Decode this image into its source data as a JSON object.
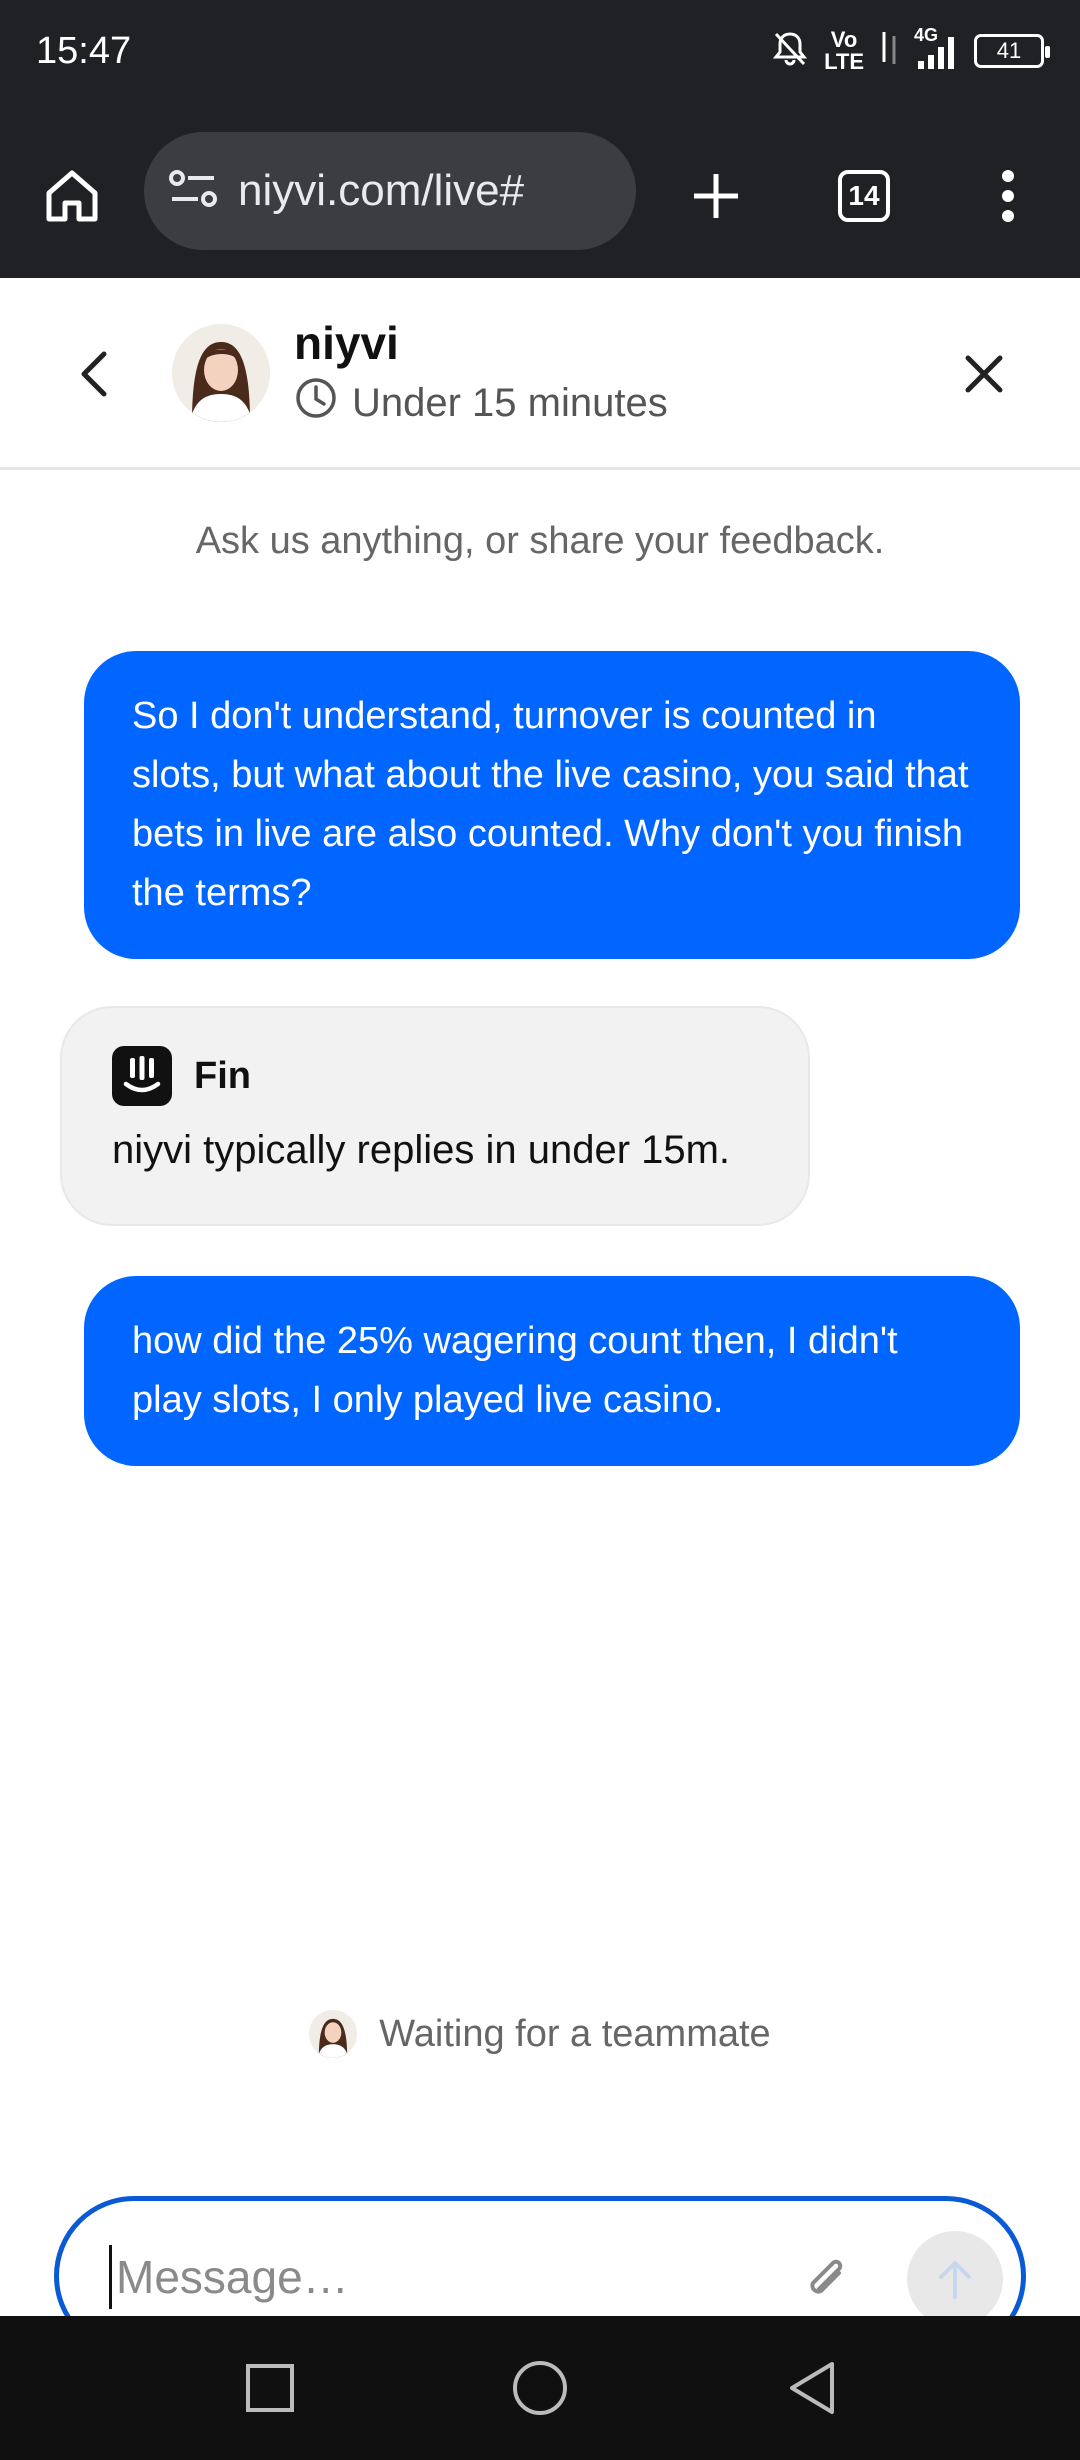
{
  "status_bar": {
    "time": "15:47",
    "network_volte": "Vo\nLTE",
    "network_type": "4G",
    "battery": "41",
    "icons": [
      "do-not-disturb-icon",
      "volte-icon",
      "data-arrows-icon",
      "signal-icon",
      "battery-icon"
    ]
  },
  "browser": {
    "url": "niyvi.com/live#",
    "tab_count": "14",
    "icons": [
      "home-icon",
      "site-settings-icon",
      "new-tab-icon",
      "tab-switcher-icon",
      "more-icon"
    ]
  },
  "chat_header": {
    "name": "niyvi",
    "response_time": "Under 15 minutes",
    "icons": [
      "back-icon",
      "avatar",
      "clock-icon",
      "close-icon"
    ]
  },
  "chat": {
    "intro": "Ask us anything, or share your feedback.",
    "messages": [
      {
        "from": "user",
        "text": "So I don't understand, turnover is counted in slots, but what about the live casino, you said that bets in live are also counted. Why don't you finish the terms?"
      },
      {
        "from": "bot",
        "sender": "Fin",
        "text": "niyvi typically replies in under 15m."
      },
      {
        "from": "user",
        "text": "how did the 25% wagering count then, I didn't play slots, I only played live casino."
      }
    ],
    "waiting": "Waiting for a teammate"
  },
  "composer": {
    "placeholder": "Message…",
    "value": ""
  },
  "colors": {
    "user_bubble": "#0066ff",
    "bot_bubble": "#f2f2f2",
    "chrome_bar": "#202124",
    "composer_border": "#0a5ad6"
  }
}
